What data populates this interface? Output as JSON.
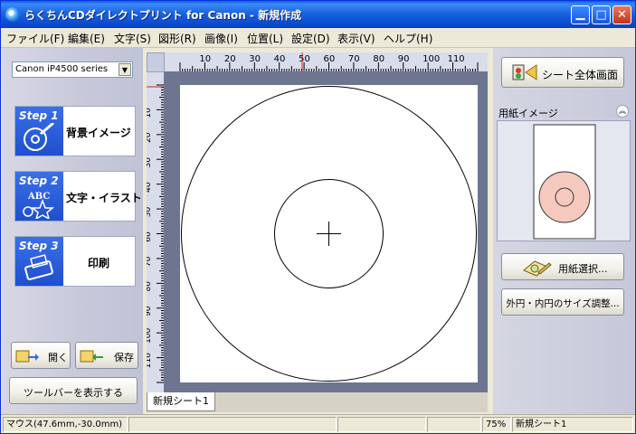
{
  "window": {
    "title": "らくちんCDダイレクトプリント for Canon - 新規作成"
  },
  "menu": [
    "ファイル(F)",
    "編集(E)",
    "文字(S)",
    "図形(R)",
    "画像(I)",
    "位置(L)",
    "設定(D)",
    "表示(V)",
    "ヘルプ(H)"
  ],
  "printer": {
    "selected": "Canon iP4500 series"
  },
  "steps": [
    {
      "badge": "Step 1",
      "label": "背景イメージ",
      "icon": "cd-brush-icon"
    },
    {
      "badge": "Step 2",
      "label": "文字・イラスト",
      "icon": "abc-star-icon"
    },
    {
      "badge": "Step 3",
      "label": "印刷",
      "icon": "printer-icon"
    }
  ],
  "file_buttons": {
    "open": "開く",
    "save": "保存"
  },
  "toolbar_toggle": "ツールバーを表示する",
  "ruler": {
    "h_labels": [
      "10",
      "20",
      "30",
      "40",
      "50",
      "60",
      "70",
      "80",
      "90",
      "100",
      "110"
    ],
    "v_labels": [
      "10",
      "20",
      "30",
      "40",
      "50",
      "60",
      "70",
      "80",
      "90",
      "100",
      "110"
    ]
  },
  "sheet_tab": "新規シート1",
  "right": {
    "full_view_button": "シート全体画面",
    "paper_image_header": "用紙イメージ",
    "paper_select_button": "用紙選択...",
    "size_adjust_button": "外円・内円のサイズ調整..."
  },
  "status": {
    "mouse": "マウス(47.6mm,-30.0mm)",
    "zoom": "75%",
    "sheet": "新規シート1"
  },
  "colors": {
    "title_bar": "#0A5FDE",
    "step_badge": "#1F4FCF",
    "disc_preview_fill": "#F6C9BE"
  }
}
